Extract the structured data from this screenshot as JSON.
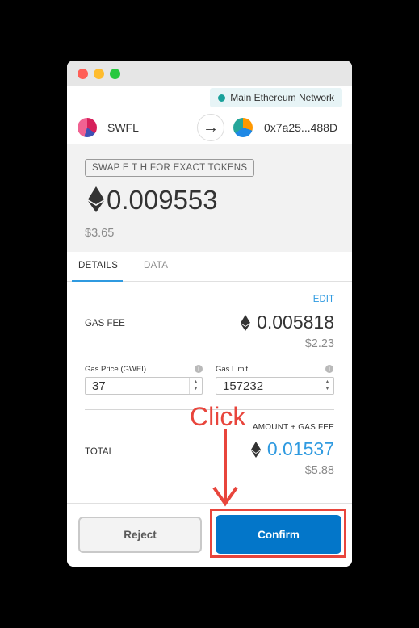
{
  "network": {
    "label": "Main Ethereum Network",
    "status_color": "#1aa19b"
  },
  "accounts": {
    "from_name": "SWFL",
    "to_address": "0x7a25...488D"
  },
  "summary": {
    "method": "SWAP E T H FOR EXACT TOKENS",
    "amount": "0.009553",
    "fiat": "$3.65"
  },
  "tabs": {
    "details": "DETAILS",
    "data": "DATA",
    "active": "DETAILS"
  },
  "details": {
    "edit_label": "EDIT",
    "gas_fee_label": "GAS FEE",
    "gas_fee_eth": "0.005818",
    "gas_fee_fiat": "$2.23",
    "gas_price_label": "Gas Price (GWEI)",
    "gas_price_value": "37",
    "gas_limit_label": "Gas Limit",
    "gas_limit_value": "157232",
    "amount_gas_label": "AMOUNT + GAS FEE",
    "total_label": "TOTAL",
    "total_eth": "0.01537",
    "total_fiat": "$5.88"
  },
  "buttons": {
    "reject": "Reject",
    "confirm": "Confirm"
  },
  "annotation": {
    "click_label": "Click",
    "color": "#e8453c"
  },
  "colors": {
    "accent": "#2f9ae0",
    "confirm_bg": "#0376c9"
  }
}
